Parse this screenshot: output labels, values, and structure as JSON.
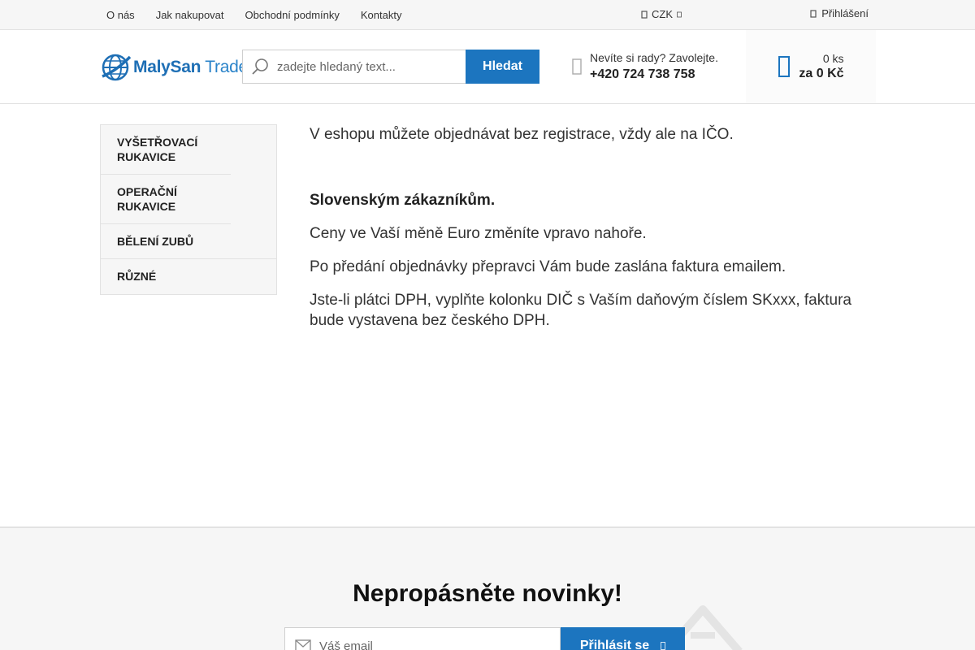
{
  "topbar": {
    "links": [
      "O nás",
      "Jak nakupovat",
      "Obchodní podmínky",
      "Kontakty"
    ],
    "currency": "CZK",
    "login": "Přihlášení"
  },
  "header": {
    "logo": {
      "bold": "MalySan",
      "light": " Trade"
    },
    "search": {
      "placeholder": "zadejte hledaný text...",
      "button": "Hledat"
    },
    "help": {
      "question": "Nevíte si rady? Zavolejte.",
      "phone": "+420 724 738 758"
    },
    "cart": {
      "quantity": "0 ks",
      "total": "za 0 Kč"
    }
  },
  "sidebar": {
    "items": [
      {
        "label": "Vyšetřovací rukavice"
      },
      {
        "label": "Operační rukavice"
      },
      {
        "label": "Bělení zubů"
      },
      {
        "label": "Různé"
      }
    ]
  },
  "content": {
    "p1": "V eshopu můžete objednávat bez registrace, vždy ale na IČO.",
    "heading": "Slovenským zákazníkům.",
    "p2": "Ceny ve Vaší měně Euro změníte vpravo nahoře.",
    "p3": "Po předání objednávky přepravci Vám bude zaslána faktura emailem.",
    "p4": "Jste-li plátci DPH, vyplňte kolonku DIČ s Vaším daňovým číslem SKxxx, faktura bude vystavena bez českého DPH."
  },
  "newsletter": {
    "title": "Nepropásněte novinky!",
    "placeholder": "Váš email",
    "button": "Přihlásit se"
  },
  "colors": {
    "accent": "#1c75bf",
    "bar": "#f6f6f6",
    "border": "#e2e2e2"
  }
}
